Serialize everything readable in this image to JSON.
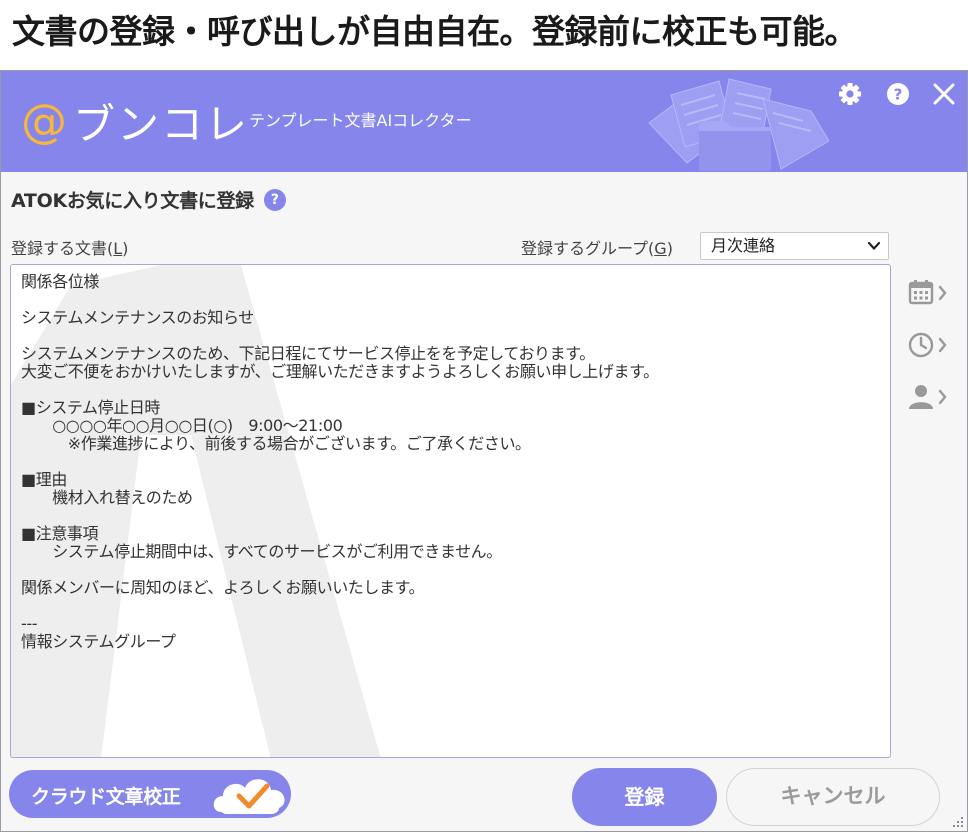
{
  "caption": "文書の登録・呼び出しが自由自在。登録前に校正も可能。",
  "header": {
    "logo_at": "@",
    "logo_text": "ブンコレ",
    "subtitle": "テンプレート文書AIコレクター",
    "icons": [
      "gear-icon",
      "help-icon",
      "close-icon"
    ]
  },
  "form": {
    "title": "ATOKお気に入り文書に登録",
    "help_glyph": "?",
    "doc_label": "登録する文書(",
    "doc_label_key": "L",
    "doc_label_end": ")",
    "group_label": "登録するグループ(",
    "group_label_key": "G",
    "group_label_end": ")",
    "group_value": "月次連絡"
  },
  "document": {
    "lines": [
      "関係各位様",
      "",
      "システムメンテナンスのお知らせ",
      "",
      "システムメンテナンスのため、下記日程にてサービス停止をを予定しております。",
      "大変ご不便をおかけいたしますが、ご理解いただきますようよろしくお願い申し上げます。",
      "",
      "■システム停止日時",
      "　　○○○○年○○月○○日(○)　9:00～21:00",
      "　　　※作業進捗により、前後する場合がございます。ご了承ください。",
      "",
      "■理由",
      "　　機材入れ替えのため",
      "",
      "■注意事項",
      "　　システム停止期間中は、すべてのサービスがご利用できません。",
      "",
      "関係メンバーに周知のほど、よろしくお願いいたします。",
      "",
      "---",
      "情報システムグループ"
    ]
  },
  "side_tools": [
    "calendar-icon",
    "clock-icon",
    "person-icon"
  ],
  "buttons": {
    "cloud": "クラウド文章校正",
    "register": "登録",
    "cancel": "キャンセル"
  },
  "colors": {
    "accent": "#8585ec",
    "logo_at": "#f6b73c",
    "check": "#f08a2c"
  }
}
